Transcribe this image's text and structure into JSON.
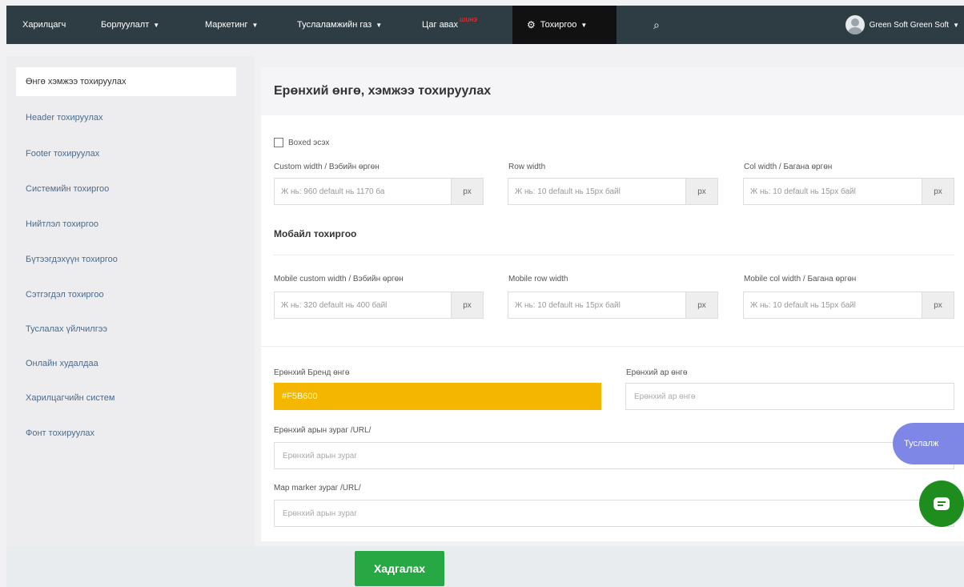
{
  "nav": {
    "items": [
      {
        "label": "Харилцагч",
        "caret": false
      },
      {
        "label": "Борлуулалт",
        "caret": true
      },
      {
        "label": "Маркетинг",
        "caret": true
      },
      {
        "label": "Туслаламжийн газ",
        "caret": true
      },
      {
        "label": "Цаг авах",
        "caret": false,
        "badge": "шинэ"
      }
    ],
    "settings_label": "Тохиргоо",
    "search_icon": "search-icon",
    "user_name": "Green Soft Green Soft"
  },
  "sidebar": {
    "items": [
      {
        "label": "Өнгө хэмжээ тохируулах",
        "active": true
      },
      {
        "label": "Header тохируулах"
      },
      {
        "label": "Footer тохируулах"
      },
      {
        "label": "Системийн тохиргоо"
      },
      {
        "label": "Нийтлэл тохиргоо"
      },
      {
        "label": "Бүтээгдэхүүн тохиргоо"
      },
      {
        "label": "Сэтгэгдэл тохиргоо"
      },
      {
        "label": "Туслалах үйлчилгээ"
      },
      {
        "label": "Онлайн худалдаа"
      },
      {
        "label": "Харилцагчийн систем"
      },
      {
        "label": "Фонт тохируулах"
      }
    ]
  },
  "main": {
    "title": "Ерөнхий өнгө, хэмжээ тохируулах",
    "boxed_label": "Boxed эсэх",
    "desktop": {
      "custom_width": {
        "label": "Custom width / Вэбийн өргөн",
        "placeholder": "Ж нь: 960 default нь 1170 ба",
        "unit": "px"
      },
      "row_width": {
        "label": "Row width",
        "placeholder": "Ж нь: 10 default нь 15px байl",
        "unit": "px"
      },
      "col_width": {
        "label": "Col width / Багана өргөн",
        "placeholder": "Ж нь: 10 default нь 15px байl",
        "unit": "px"
      }
    },
    "mobile_title": "Мобайл тохиргоо",
    "mobile": {
      "custom_width": {
        "label": "Mobile custom width / Вэбийн өргөн",
        "placeholder": "Ж нь: 320 default нь 400 байl",
        "unit": "px"
      },
      "row_width": {
        "label": "Mobile row width",
        "placeholder": "Ж нь: 10 default нь 15px байl",
        "unit": "px"
      },
      "col_width": {
        "label": "Mobile col width / Багана өргөн",
        "placeholder": "Ж нь: 10 default нь 15px байl",
        "unit": "px"
      }
    },
    "brand_color": {
      "label": "Ерөнхий Бренд өнгө",
      "value": "#F5B600",
      "color": "#F5B600"
    },
    "bg_color": {
      "label": "Ерөнхий ар өнгө",
      "placeholder": "Ерөнхий ар өнгө"
    },
    "bg_image": {
      "label": "Ерөнхий арын зураг /URL/",
      "placeholder": "Ерөнхий арын зураг"
    },
    "map_marker": {
      "label": "Map marker зураг /URL/",
      "placeholder": "Ерөнхий арын зураг"
    }
  },
  "actions": {
    "save_label": "Хадгалах",
    "help_label": "Туслалж"
  },
  "colors": {
    "nav_bg": "#2E3D44",
    "brand": "#F5B600",
    "save": "#28A745",
    "help": "#7E86E6",
    "chat": "#1E8D1E"
  }
}
